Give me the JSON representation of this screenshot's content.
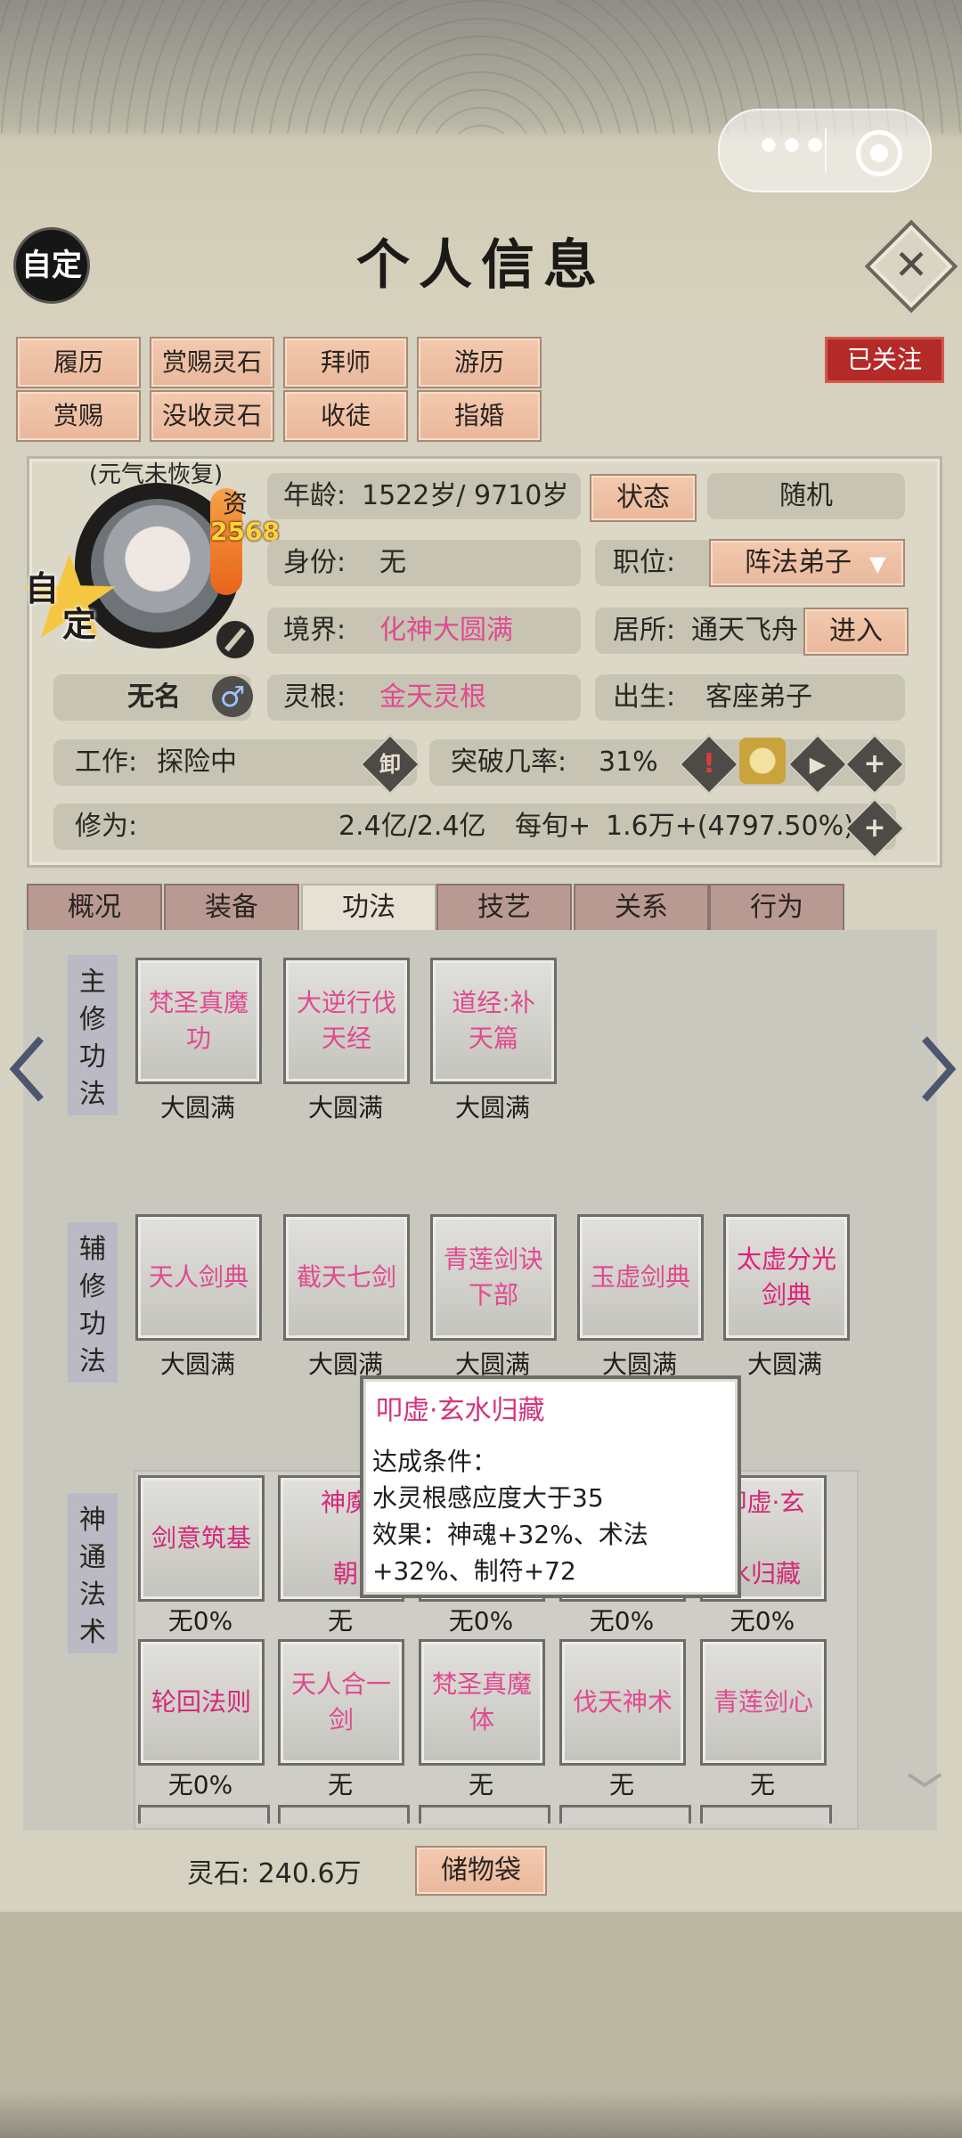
{
  "header": {
    "title": "个人信息",
    "auto_label": "自定"
  },
  "top_buttons": [
    {
      "label": "履历"
    },
    {
      "label": "赏赐灵石"
    },
    {
      "label": "拜师"
    },
    {
      "label": "游历"
    },
    {
      "label": "赏赐"
    },
    {
      "label": "没收灵石"
    },
    {
      "label": "收徒"
    },
    {
      "label": "指婚"
    }
  ],
  "followed_label": "已关注",
  "profile": {
    "status_note": "(元气未恢复)",
    "zi_label": "资",
    "zi_value": "2568",
    "star_text": [
      "自",
      "定"
    ],
    "name": "无名",
    "age_label": "年龄:",
    "age_value": "1522岁/ 9710岁",
    "state_button": "状态",
    "random_button": "随机",
    "identity_label": "身份:",
    "identity_value": "无",
    "position_label": "职位:",
    "position_value": "阵法弟子",
    "realm_label": "境界:",
    "realm_value": "化神大圆满",
    "residence_label": "居所:",
    "residence_value": "通天飞舟",
    "enter_button": "进入",
    "root_label": "灵根:",
    "root_value": "金天灵根",
    "birth_label": "出生:",
    "birth_value": "客座弟子",
    "work_label": "工作:",
    "work_value": "探险中",
    "unload_icon_text": "卸",
    "breakthrough_label": "突破几率:",
    "breakthrough_value": "31%",
    "cultivation_label": "修为:",
    "cultivation_value": "2.4亿/2.4亿",
    "per_tick_label": "每旬+",
    "per_tick_value": "1.6万+(4797.50%)"
  },
  "tabs": [
    {
      "label": "概况"
    },
    {
      "label": "装备"
    },
    {
      "label": "功法",
      "active": true
    },
    {
      "label": "技艺"
    },
    {
      "label": "关系"
    },
    {
      "label": "行为"
    }
  ],
  "sections": {
    "main": {
      "label": "主修功法",
      "items": [
        {
          "name": "梵圣真魔功",
          "status": "大圆满"
        },
        {
          "name": "大逆行伐天经",
          "status": "大圆满"
        },
        {
          "name": "道经:补天篇",
          "status": "大圆满"
        }
      ]
    },
    "aux": {
      "label": "辅修功法",
      "items": [
        {
          "name": "天人剑典",
          "status": "大圆满"
        },
        {
          "name": "截天七剑",
          "status": "大圆满"
        },
        {
          "name": "青莲剑诀下部",
          "status": "大圆满"
        },
        {
          "name": "玉虚剑典",
          "status": "大圆满"
        },
        {
          "name": "太虚分光剑典",
          "status": "大圆满"
        }
      ]
    },
    "divine": {
      "label": "神通法术",
      "row1": [
        {
          "name": "剑意筑基",
          "status": "无0%"
        },
        {
          "name": "神魔",
          "status": "无"
        },
        {
          "name": "",
          "status": "无0%"
        },
        {
          "name": "",
          "status": "无0%"
        },
        {
          "name": "叩虚·玄水归藏",
          "status": "无0%"
        }
      ],
      "row2": [
        {
          "name": "轮回法则",
          "status": "无0%"
        },
        {
          "name": "天人合一剑",
          "status": "无"
        },
        {
          "name": "梵圣真魔体",
          "status": "无"
        },
        {
          "name": "伐天神术",
          "status": "无"
        },
        {
          "name": "青莲剑心",
          "status": "无"
        }
      ],
      "row1_visible_fragments": [
        "神魔",
        "朝",
        "叩虚·玄",
        "水归藏"
      ]
    }
  },
  "tooltip": {
    "title": "叩虚·玄水归藏",
    "line1": "达成条件：",
    "line2": "水灵根感应度大于35",
    "line3": "效果：神魂+32%、术法",
    "line4": "+32%、制符+72"
  },
  "footer": {
    "spirit_stone_label": "灵石:",
    "spirit_stone_value": "240.6万",
    "storage_button": "储物袋"
  },
  "colors": {
    "pink_text": "#e04a90",
    "deep_pink": "#d2347c",
    "orange_button": "#eebfa3",
    "red_badge": "#b42a28"
  }
}
